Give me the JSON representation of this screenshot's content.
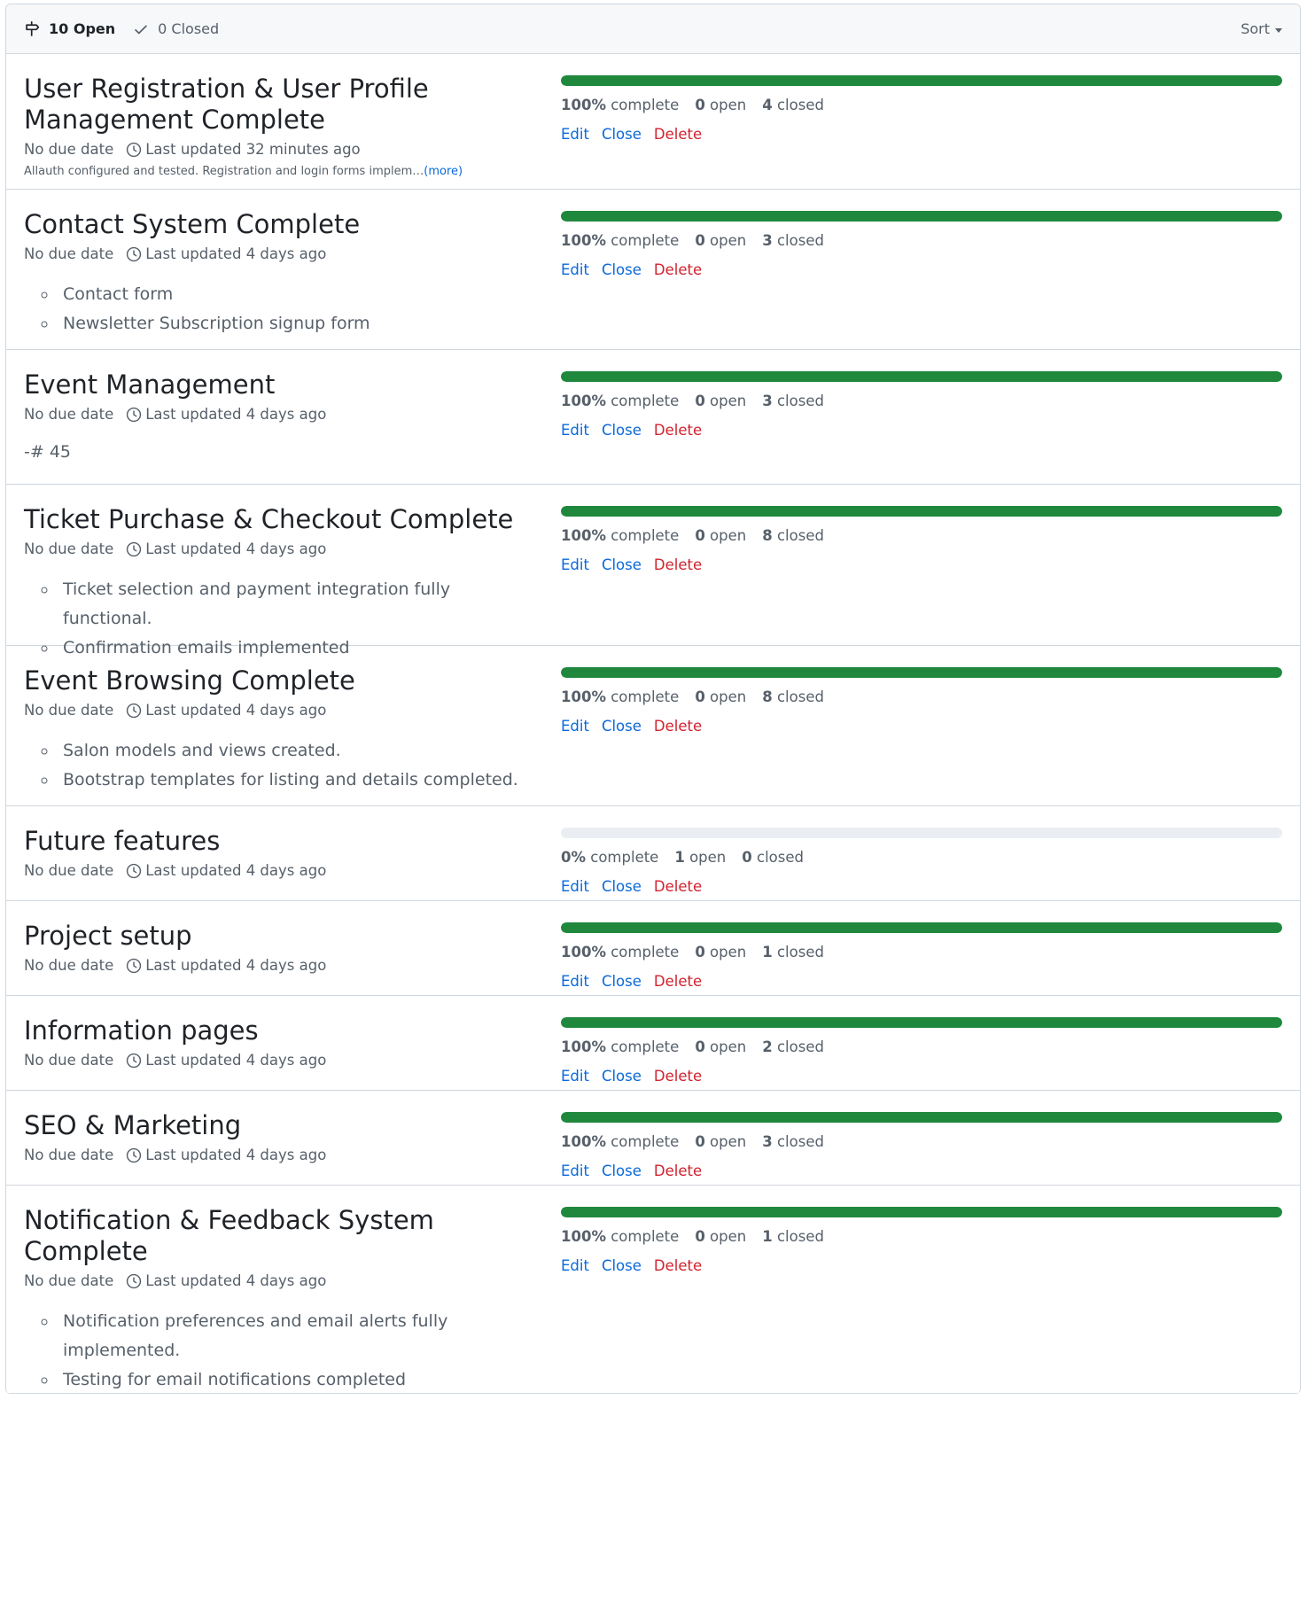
{
  "header": {
    "open_label": "10 Open",
    "closed_label": "0 Closed",
    "sort_label": "Sort"
  },
  "labels": {
    "complete": "complete",
    "open": "open",
    "closed": "closed",
    "edit": "Edit",
    "close": "Close",
    "delete": "Delete"
  },
  "colors": {
    "progress": "#1f883d",
    "link": "#0969da",
    "danger": "#cf222e"
  },
  "milestones": [
    {
      "title": "User Registration & User Profile Management Complete",
      "due": "No due date",
      "updated": "Last updated 32 minutes ago",
      "summary": "Allauth configured and tested. Registration and login forms implem…",
      "more": "(more)",
      "percent": "100%",
      "progress": 100,
      "open": "0",
      "closed": "4"
    },
    {
      "title": "Contact System Complete",
      "due": "No due date",
      "updated": "Last updated 4 days ago",
      "items": [
        "Contact form",
        "Newsletter Subscription signup form"
      ],
      "percent": "100%",
      "progress": 100,
      "open": "0",
      "closed": "3"
    },
    {
      "title": "Event Management",
      "due": "No due date",
      "updated": "Last updated 4 days ago",
      "text": "-# 45",
      "percent": "100%",
      "progress": 100,
      "open": "0",
      "closed": "3"
    },
    {
      "title": "Ticket Purchase & Checkout Complete",
      "due": "No due date",
      "updated": "Last updated 4 days ago",
      "items": [
        "Ticket selection and payment integration fully functional.",
        "Confirmation emails implemented"
      ],
      "percent": "100%",
      "progress": 100,
      "open": "0",
      "closed": "8"
    },
    {
      "title": "Event Browsing Complete",
      "due": "No due date",
      "updated": "Last updated 4 days ago",
      "items": [
        "Salon models and views created.",
        "Bootstrap templates for listing and details completed."
      ],
      "percent": "100%",
      "progress": 100,
      "open": "0",
      "closed": "8"
    },
    {
      "title": "Future features",
      "due": "No due date",
      "updated": "Last updated 4 days ago",
      "percent": "0%",
      "progress": 0,
      "open": "1",
      "closed": "0"
    },
    {
      "title": "Project setup",
      "due": "No due date",
      "updated": "Last updated 4 days ago",
      "percent": "100%",
      "progress": 100,
      "open": "0",
      "closed": "1"
    },
    {
      "title": "Information pages",
      "due": "No due date",
      "updated": "Last updated 4 days ago",
      "percent": "100%",
      "progress": 100,
      "open": "0",
      "closed": "2"
    },
    {
      "title": "SEO & Marketing",
      "due": "No due date",
      "updated": "Last updated 4 days ago",
      "percent": "100%",
      "progress": 100,
      "open": "0",
      "closed": "3"
    },
    {
      "title": "Notification & Feedback System Complete",
      "due": "No due date",
      "updated": "Last updated 4 days ago",
      "items": [
        "Notification preferences and email alerts fully implemented.",
        "Testing for email notifications completed"
      ],
      "percent": "100%",
      "progress": 100,
      "open": "0",
      "closed": "1"
    }
  ]
}
